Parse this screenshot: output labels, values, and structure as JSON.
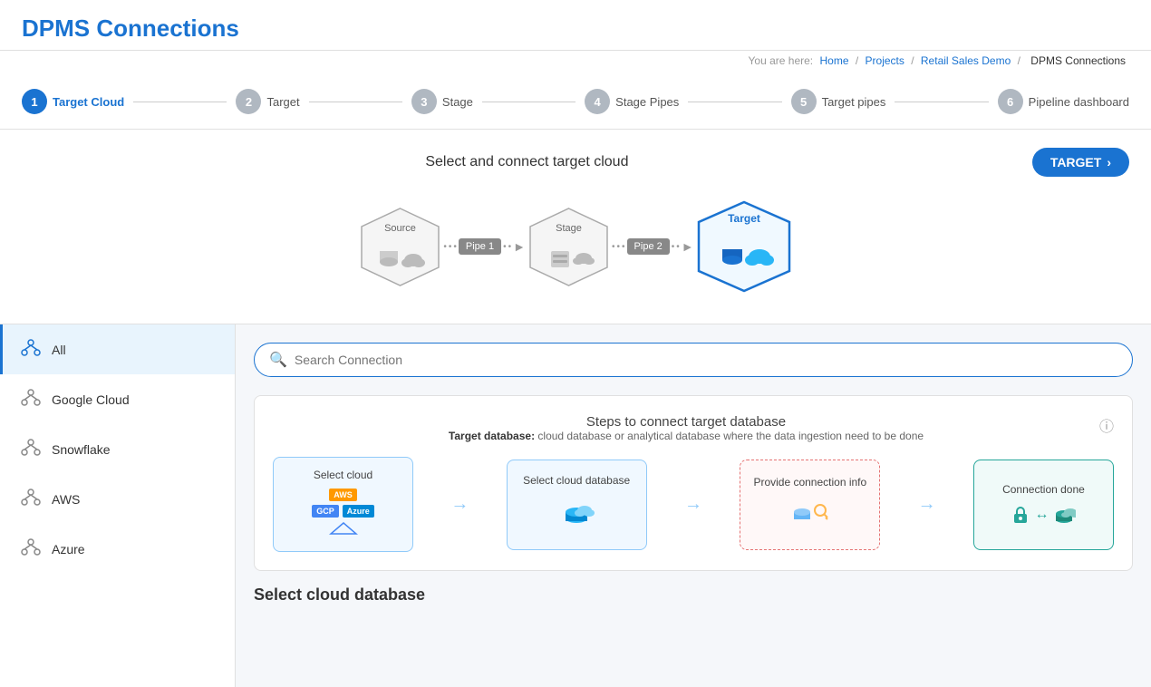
{
  "app": {
    "title": "DPMS Connections"
  },
  "breadcrumb": {
    "you_are_here": "You are here:",
    "items": [
      "Home",
      "Projects",
      "Retail Sales Demo",
      "DPMS Connections"
    ],
    "separators": [
      "/",
      "/",
      "/"
    ]
  },
  "stepper": {
    "steps": [
      {
        "number": "1",
        "label": "Target Cloud",
        "active": true
      },
      {
        "number": "2",
        "label": "Target",
        "active": false
      },
      {
        "number": "3",
        "label": "Stage",
        "active": false
      },
      {
        "number": "4",
        "label": "Stage Pipes",
        "active": false
      },
      {
        "number": "5",
        "label": "Target pipes",
        "active": false
      },
      {
        "number": "6",
        "label": "Pipeline dashboard",
        "active": false
      }
    ]
  },
  "pipeline": {
    "title": "Select and connect target cloud",
    "target_button": "TARGET",
    "nodes": [
      {
        "label": "Source",
        "type": "source"
      },
      {
        "label": "Pipe 1",
        "type": "pipe"
      },
      {
        "label": "Stage",
        "type": "stage"
      },
      {
        "label": "Pipe 2",
        "type": "pipe"
      },
      {
        "label": "Target",
        "type": "target"
      }
    ]
  },
  "search": {
    "placeholder": "Search Connection"
  },
  "sidebar": {
    "items": [
      {
        "label": "All",
        "active": true
      },
      {
        "label": "Google Cloud",
        "active": false
      },
      {
        "label": "Snowflake",
        "active": false
      },
      {
        "label": "AWS",
        "active": false
      },
      {
        "label": "Azure",
        "active": false
      }
    ]
  },
  "steps_card": {
    "title": "Steps to connect target database",
    "subtitle_prefix": "Target database:",
    "subtitle_desc": "cloud database or analytical database where the data ingestion need to be done",
    "help_tooltip": "Help",
    "steps": [
      {
        "label": "Select cloud",
        "type": "cloud-select"
      },
      {
        "label": "Select cloud database",
        "type": "db-select"
      },
      {
        "label": "Provide connection info",
        "type": "connection-info"
      },
      {
        "label": "Connection done",
        "type": "done"
      }
    ]
  },
  "section": {
    "select_cloud_db": "Select cloud database"
  }
}
